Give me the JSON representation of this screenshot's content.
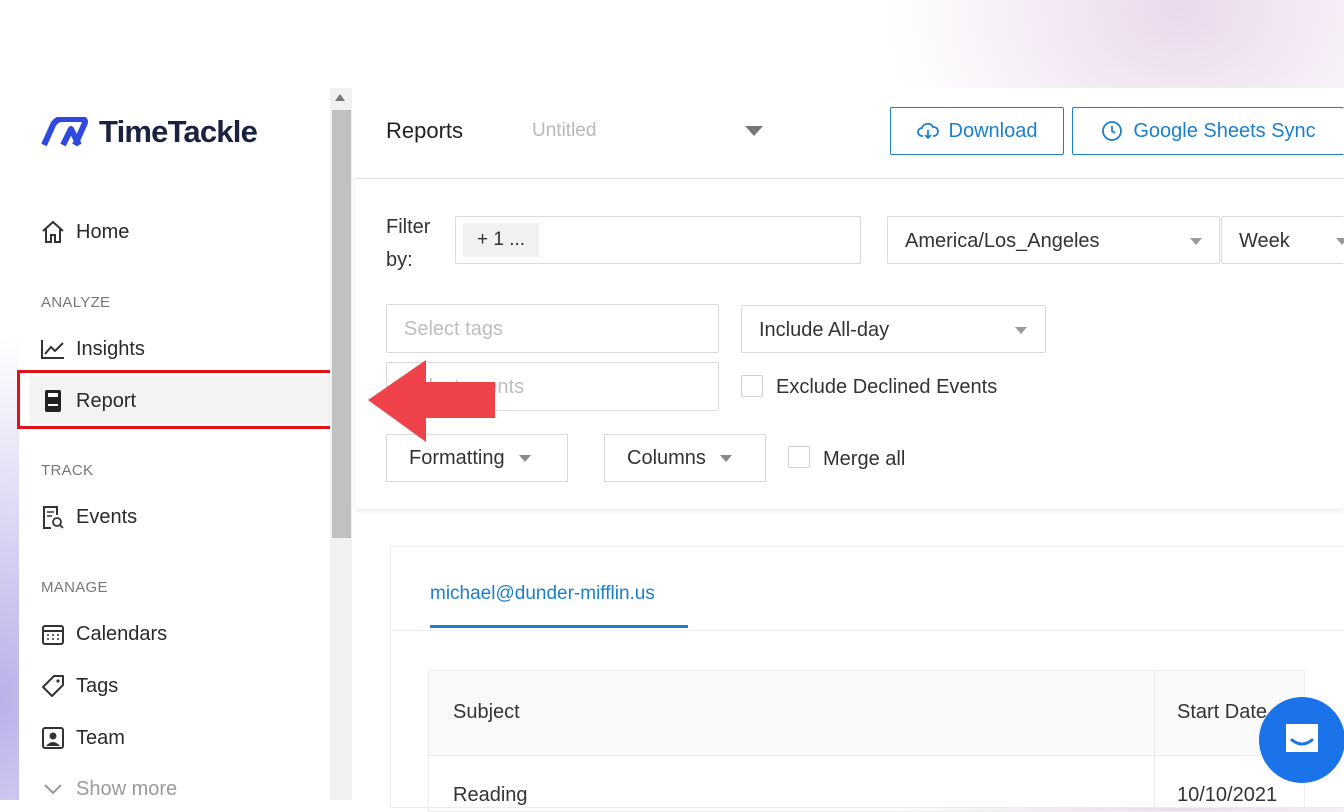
{
  "app": {
    "brand": "TimeTackle",
    "accent_color": "#1b7fd0",
    "highlight_color": "#e3101a"
  },
  "sidebar": {
    "home": {
      "label": "Home",
      "icon": "home-icon"
    },
    "sections": {
      "analyze": "ANALYZE",
      "track": "TRACK",
      "manage": "MANAGE"
    },
    "insights": {
      "label": "Insights",
      "icon": "chart-line-icon"
    },
    "report": {
      "label": "Report",
      "icon": "report-icon",
      "active": true
    },
    "events": {
      "label": "Events",
      "icon": "events-search-icon"
    },
    "calendars": {
      "label": "Calendars",
      "icon": "calendar-icon"
    },
    "tags": {
      "label": "Tags",
      "icon": "tag-icon"
    },
    "team": {
      "label": "Team",
      "icon": "team-icon"
    },
    "show_more": {
      "label": "Show more",
      "icon": "chevron-down-icon"
    }
  },
  "header": {
    "title": "Reports",
    "report_name_placeholder": "Untitled",
    "download_label": "Download",
    "sheets_sync_label": "Google Sheets Sync"
  },
  "filters": {
    "filter_by_label_1": "Filter",
    "filter_by_label_2": "by:",
    "filter_chip": "+ 1 ...",
    "timezone": "America/Los_Angeles",
    "period": "Week",
    "tags_placeholder": "Select tags",
    "events_placeholder": "Select events",
    "all_day": "Include All-day",
    "exclude_declined": "Exclude Declined Events",
    "formatting": "Formatting",
    "columns": "Columns",
    "merge_all": "Merge all"
  },
  "report": {
    "tab_email": "michael@dunder-mifflin.us",
    "columns": [
      "Subject",
      "Start Date"
    ],
    "rows": [
      {
        "subject": "Reading",
        "start_date": "10/10/2021"
      }
    ]
  }
}
